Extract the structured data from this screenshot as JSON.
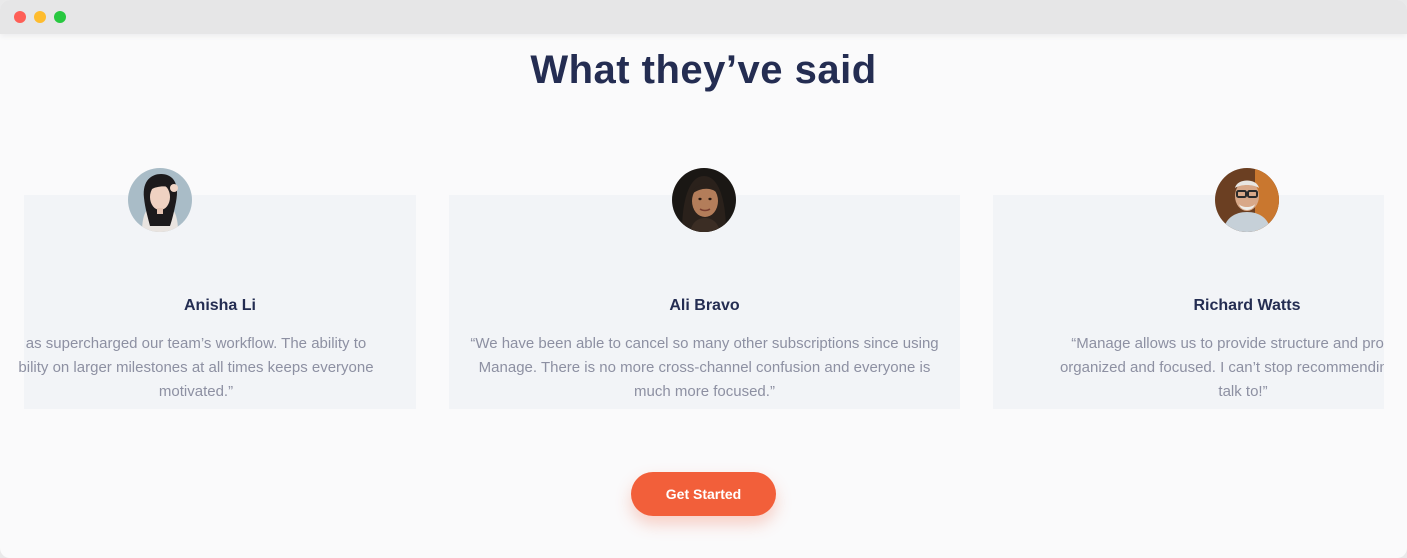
{
  "window": {
    "traffic_lights": [
      "close",
      "minimize",
      "zoom"
    ]
  },
  "section": {
    "title": "What they’ve said"
  },
  "testimonials": [
    {
      "name": "Anisha Li",
      "quote_lines": [
        "as supercharged our team’s workflow. The ability to",
        "bility on larger milestones at all times keeps everyone",
        "motivated.”"
      ]
    },
    {
      "name": "Ali Bravo",
      "quote_lines": [
        "“We have been able to cancel so many other subscriptions since using",
        "Manage. There is no more cross-channel confusion and everyone is",
        "much more focused.”"
      ]
    },
    {
      "name": "Richard Watts",
      "quote_lines": [
        "“Manage allows us to provide structure and process",
        "organized and focused. I can’t stop recommending ther",
        "talk to!”"
      ]
    }
  ],
  "cta": {
    "label": "Get Started"
  },
  "colors": {
    "heading": "#242d52",
    "body_text": "#8d90a2",
    "card_bg": "#f2f4f7",
    "accent": "#f25f3a"
  }
}
